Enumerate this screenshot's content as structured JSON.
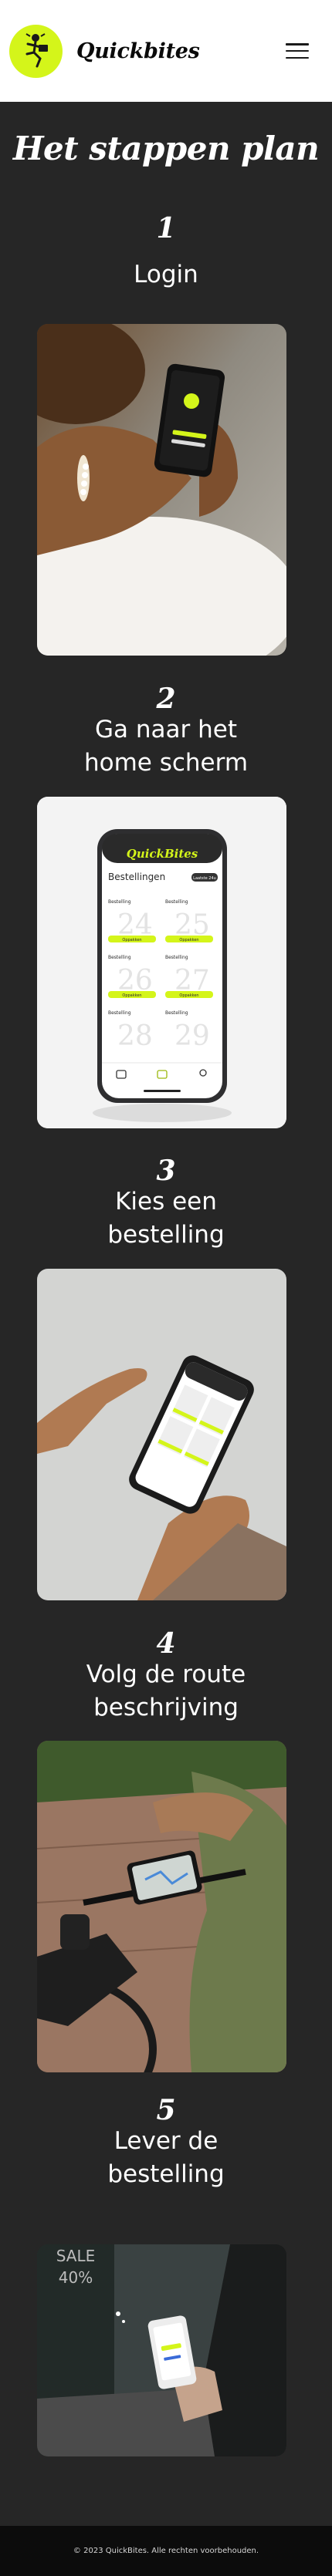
{
  "header": {
    "brand": "Quickbites",
    "logo_icon": "runner-mascot-icon",
    "menu_icon": "hamburger-menu-icon",
    "accent_color": "#d4f51a"
  },
  "page_title": "Het stappen plan",
  "steps": [
    {
      "number": "1",
      "title": "Login",
      "image": "hand-holding-phone-login-photo"
    },
    {
      "number": "2",
      "title": "Ga naar het home scherm",
      "title_line1": "Ga naar het",
      "title_line2": "home scherm",
      "image": "phone-orders-screen-photo"
    },
    {
      "number": "3",
      "title": "Kies een bestelling",
      "title_line1": "Kies een",
      "title_line2": "bestelling",
      "image": "hand-tapping-phone-photo"
    },
    {
      "number": "4",
      "title": "Volg de route beschrijving",
      "title_line1": "Volg de route",
      "title_line2": "beschrijving",
      "image": "bike-phone-navigation-photo"
    },
    {
      "number": "5",
      "title": "Lever de bestelling",
      "title_line1": "Lever de",
      "title_line2": "bestelling",
      "image": "delivery-storefront-photo"
    }
  ],
  "phone_screen": {
    "brand": "QuickBites",
    "section": "Bestellingen",
    "filter": "Laatste 24u",
    "card_label": "Bestelling",
    "action": "Oppakken",
    "dates": [
      "24",
      "25",
      "26",
      "27",
      "28",
      "29"
    ]
  },
  "footer": {
    "copyright": "© 2023 QuickBites. Alle rechten voorbehouden."
  }
}
